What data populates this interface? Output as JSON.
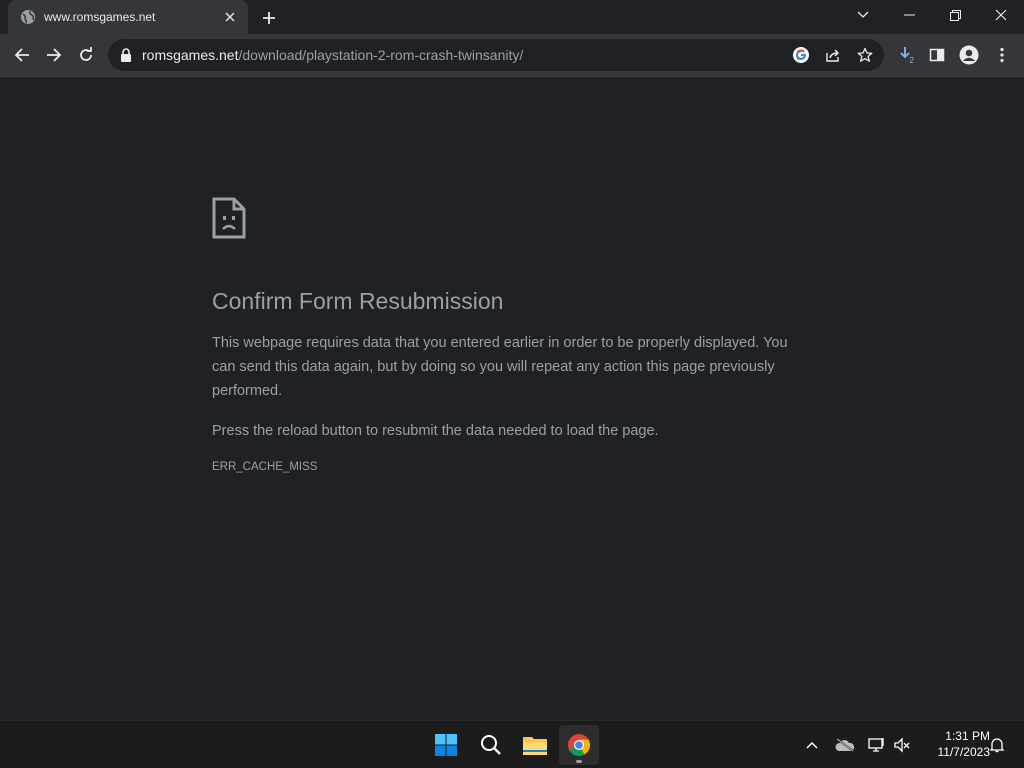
{
  "browser": {
    "tab": {
      "title": "www.romsgames.net"
    },
    "address": {
      "host": "romsgames.net",
      "path": "/download/playstation-2-rom-crash-twinsanity/"
    },
    "download_badge": "2"
  },
  "page": {
    "heading": "Confirm Form Resubmission",
    "paragraph1": "This webpage requires data that you entered earlier in order to be properly displayed. You can send this data again, but by doing so you will repeat any action this page previously performed.",
    "paragraph2": "Press the reload button to resubmit the data needed to load the page.",
    "error_code": "ERR_CACHE_MISS"
  },
  "taskbar": {
    "clock_time": "1:31 PM",
    "clock_date": "11/7/2023"
  },
  "colors": {
    "page_bg": "#202124",
    "toolbar_bg": "#35363a",
    "text_muted": "#9aa0a6"
  }
}
